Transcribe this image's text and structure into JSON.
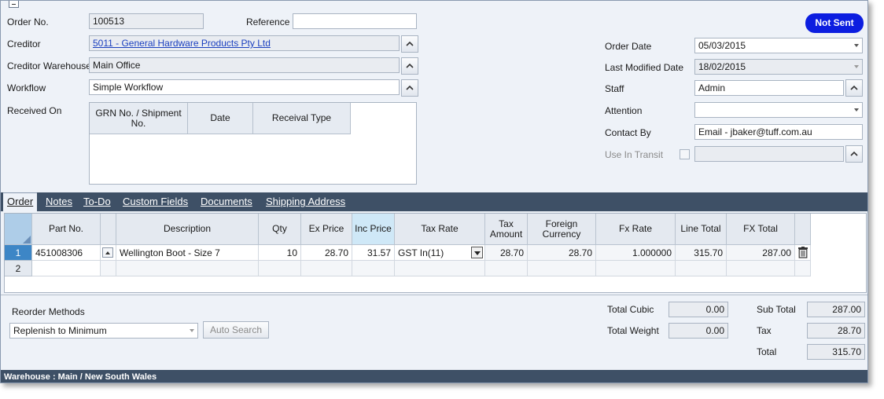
{
  "header": {
    "order_no_label": "Order No.",
    "order_no": "100513",
    "reference_label": "Reference",
    "reference": "",
    "creditor_label": "Creditor",
    "creditor": "5011 - General Hardware Products Pty Ltd",
    "creditor_warehouse_label": "Creditor Warehouse",
    "creditor_warehouse": "Main Office",
    "workflow_label": "Workflow",
    "workflow": "Simple Workflow",
    "received_on_label": "Received On",
    "status_badge": "Not Sent",
    "order_date_label": "Order Date",
    "order_date": "05/03/2015",
    "last_modified_label": "Last Modified Date",
    "last_modified": "18/02/2015",
    "staff_label": "Staff",
    "staff": "Admin",
    "attention_label": "Attention",
    "attention": "",
    "contact_by_label": "Contact By",
    "contact_by": "Email - jbaker@tuff.com.au",
    "use_in_transit_label": "Use In Transit",
    "use_in_transit": ""
  },
  "received_table": {
    "columns": [
      "GRN No. / Shipment No.",
      "Date",
      "Receival Type"
    ]
  },
  "tabs": [
    {
      "label": "Order"
    },
    {
      "label": "Notes"
    },
    {
      "label": "To-Do"
    },
    {
      "label": "Custom Fields"
    },
    {
      "label": "Documents"
    },
    {
      "label": "Shipping Address"
    }
  ],
  "order_grid": {
    "columns": {
      "part_no": "Part No.",
      "description": "Description",
      "qty": "Qty",
      "ex_price": "Ex Price",
      "inc_price": "Inc Price",
      "tax_rate": "Tax Rate",
      "tax_amount": "Tax Amount",
      "foreign_currency": "Foreign Currency",
      "fx_rate": "Fx Rate",
      "line_total": "Line Total",
      "fx_total": "FX Total"
    },
    "rows": [
      {
        "num": "1",
        "part_no": "451008306",
        "description": "Wellington Boot - Size 7",
        "qty": "10",
        "ex_price": "28.70",
        "inc_price": "31.57",
        "tax_rate": "GST In(11)",
        "tax_amount": "28.70",
        "foreign_currency": "28.70",
        "fx_rate": "1.000000",
        "line_total": "315.70",
        "fx_total": "287.00"
      },
      {
        "num": "2"
      }
    ]
  },
  "footer": {
    "reorder_label": "Reorder Methods",
    "reorder_method": "Replenish to Minimum",
    "auto_search": "Auto Search",
    "total_cubic_label": "Total Cubic",
    "total_cubic": "0.00",
    "total_weight_label": "Total Weight",
    "total_weight": "0.00",
    "sub_total_label": "Sub Total",
    "sub_total": "287.00",
    "tax_label": "Tax",
    "tax": "28.70",
    "total_label": "Total",
    "total": "315.70"
  },
  "status_bar": {
    "text": "Warehouse : Main / New South Wales"
  },
  "colors": {
    "badge": "#0c1ee0",
    "tab_bar": "#3e5066",
    "link": "#1a3fbf"
  }
}
